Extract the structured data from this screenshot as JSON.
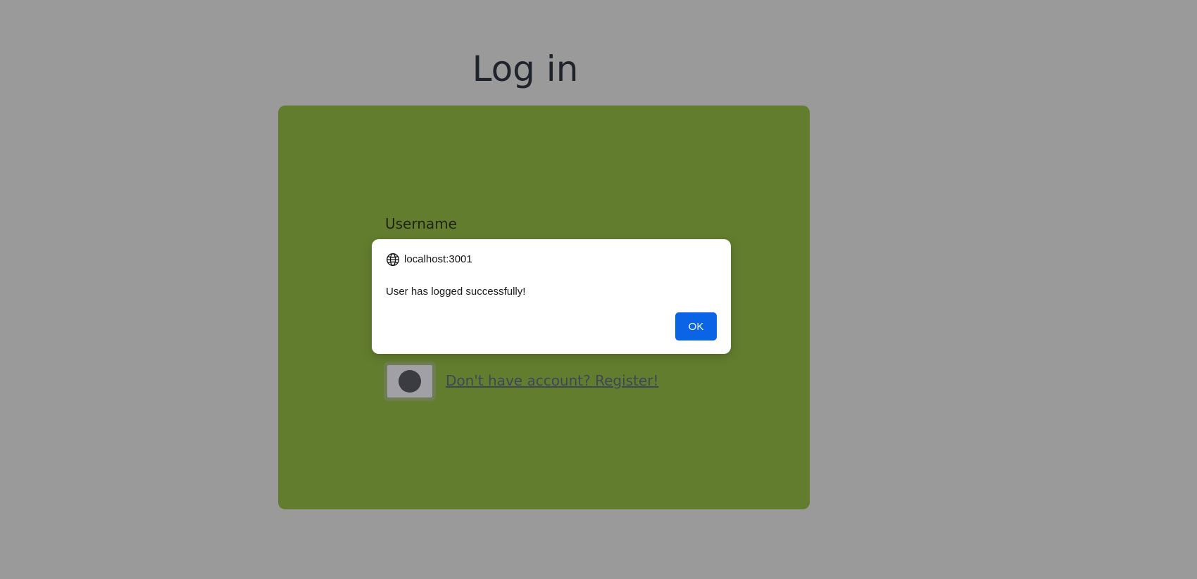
{
  "page": {
    "title": "Log in",
    "background_color": "#9a9a9b",
    "card_color": "#637d2e"
  },
  "form": {
    "username_label": "Username",
    "register_link_text": "Don't have account? Register!"
  },
  "dialog": {
    "origin": "localhost:3001",
    "origin_icon": "globe-icon",
    "message": "User has logged successfully!",
    "ok_label": "OK",
    "ok_color": "#0b63e5"
  }
}
